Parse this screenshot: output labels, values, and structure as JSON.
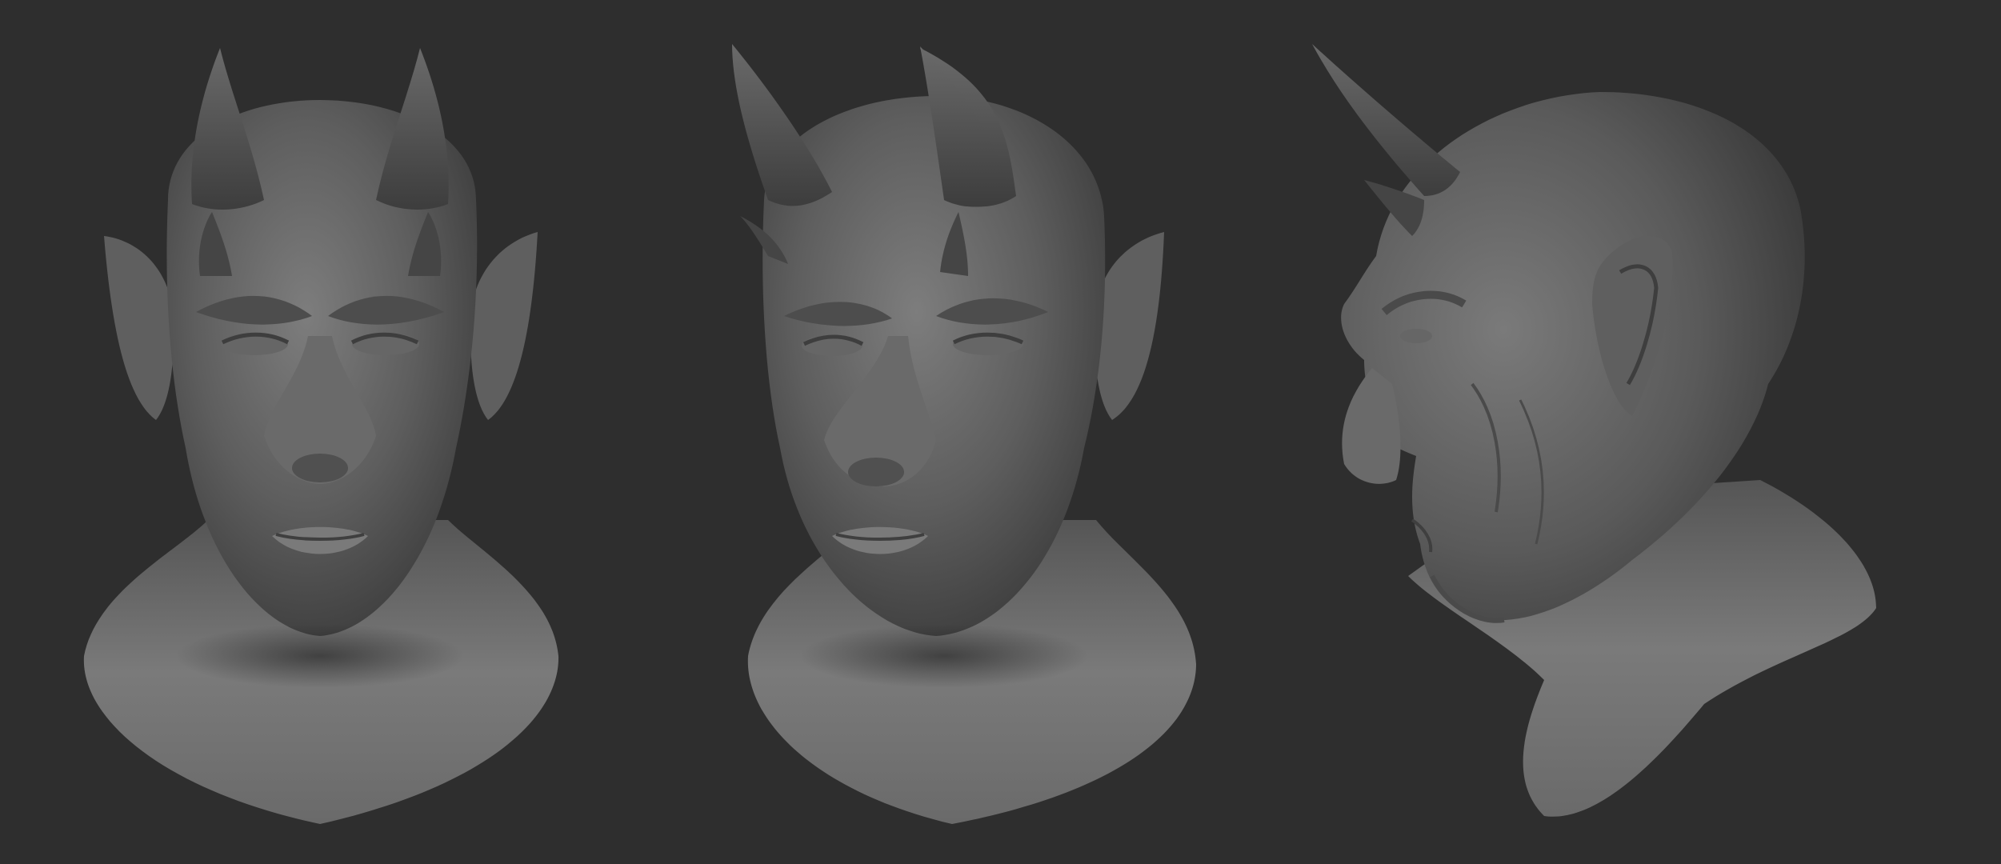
{
  "scene": {
    "background_color": "#2e2e2e",
    "subject": "demon-head-sculpt",
    "views": [
      {
        "id": "front",
        "view": "front"
      },
      {
        "id": "three-quarter",
        "view": "three-quarter"
      },
      {
        "id": "profile",
        "view": "side"
      }
    ]
  }
}
